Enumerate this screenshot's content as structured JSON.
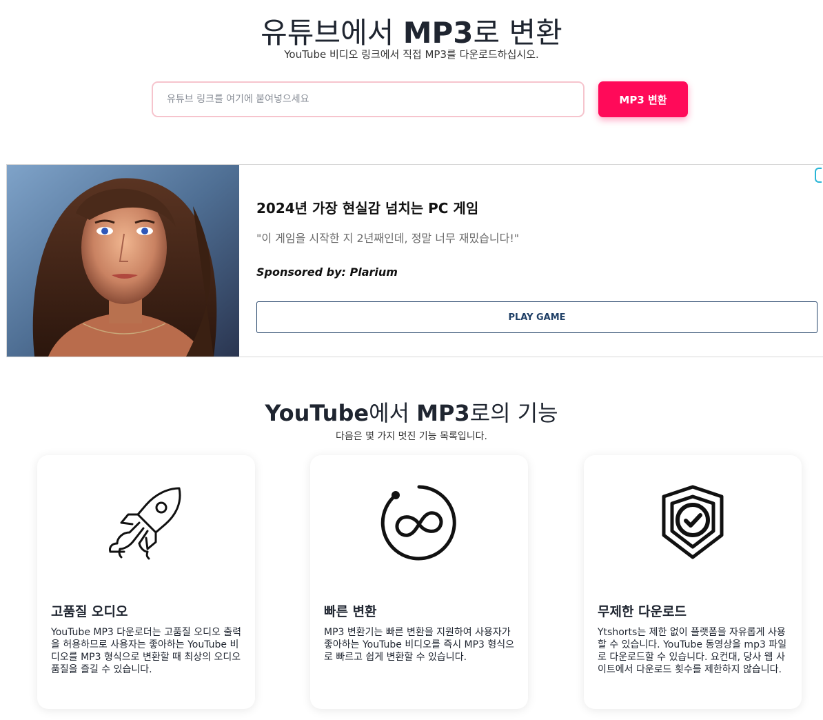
{
  "hero": {
    "title_prefix": "유튜브에서 ",
    "title_strong": "MP3",
    "title_suffix": "로 변환",
    "subtitle": "YouTube 비디오 링크에서 직접 MP3를 다운로드하십시오."
  },
  "search": {
    "placeholder": "유튜브 링크를 여기에 붙여넣으세요",
    "value": "",
    "button_label": "MP3 변환"
  },
  "ad": {
    "title": "2024년 가장 현실감 넘치는 PC 게임",
    "quote": "\"이 게임을 시작한 지 2년째인데, 정말 너무 재밌습니다!\"",
    "sponsor": "Sponsored by: Plarium",
    "button_label": "PLAY GAME"
  },
  "features": {
    "title_strong_1": "YouTube",
    "title_mid": "에서 ",
    "title_strong_2": "MP3",
    "title_suffix": "로의 기능",
    "subtitle": "다음은 몇 가지 멋진 기능 목록입니다.",
    "cards": [
      {
        "icon": "rocket-icon",
        "title": "고품질 오디오",
        "text": "YouTube MP3 다운로더는 고품질 오디오 출력을 허용하므로 사용자는 좋아하는 YouTube 비디오를 MP3 형식으로 변환할 때 최상의 오디오 품질을 즐길 수 있습니다."
      },
      {
        "icon": "infinity-icon",
        "title": "빠른 변환",
        "text": "MP3 변환기는 빠른 변환을 지원하여 사용자가 좋아하는 YouTube 비디오를 즉시 MP3 형식으로 빠르고 쉽게 변환할 수 있습니다."
      },
      {
        "icon": "shield-check-icon",
        "title": "무제한 다운로드",
        "text": "Ytshorts는 제한 없이 플랫폼을 자유롭게 사용할 수 있습니다. YouTube 동영상을 mp3 파일로 다운로드할 수 있습니다. 요컨대, 당사 웹 사이트에서 다운로드 횟수를 제한하지 않습니다."
      }
    ]
  },
  "colors": {
    "accent": "#ff0a59",
    "input_border": "#f6c4cd",
    "ad_button": "#1f3f66",
    "text": "#1f2530"
  }
}
